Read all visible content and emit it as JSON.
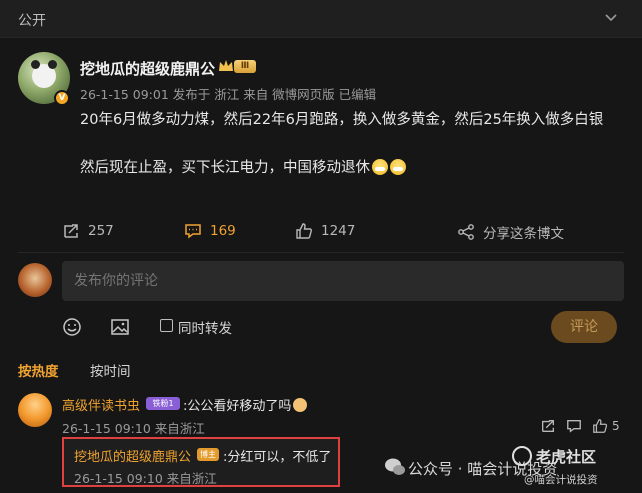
{
  "topbar": {
    "visibility": "公开"
  },
  "post": {
    "author": "挖地瓜的超级鹿鼎公",
    "level_badge": "Ⅲ",
    "meta": "26-1-15 09:01 发布于 浙江  来自 微博网页版 已编辑",
    "paragraphs": [
      "20年6月做多动力煤，然后22年6月跑路，换入做多黄金，然后25年换入做多白银",
      "然后现在止盈，买下长江电力，中国移动退休"
    ],
    "actions": {
      "repost_count": "257",
      "comment_count": "169",
      "like_count": "1247",
      "share_label": "分享这条博文"
    }
  },
  "composer": {
    "placeholder": "发布你的评论",
    "repost_label": "同时转发",
    "submit_label": "评论"
  },
  "sort": {
    "hot": "按热度",
    "time": "按时间"
  },
  "comments": [
    {
      "name": "高级伴读书虫",
      "badge": "铁粉1",
      "text": ":公公看好移动了吗",
      "meta": "26-1-15 09:10 来自浙江",
      "like_count": "5",
      "reply": {
        "name": "挖地瓜的超级鹿鼎公",
        "badge": "博主",
        "text": ":分红可以，不低了",
        "meta": "26-1-15 09:10 来自浙江"
      }
    }
  ],
  "watermark": {
    "brand": "老虎社区",
    "sub": "@喵会计说投资",
    "channel": "公众号 · 喵会计说投资"
  },
  "colors": {
    "accent": "#f0a330",
    "background": "#161616",
    "highlight_border": "#e04040"
  }
}
